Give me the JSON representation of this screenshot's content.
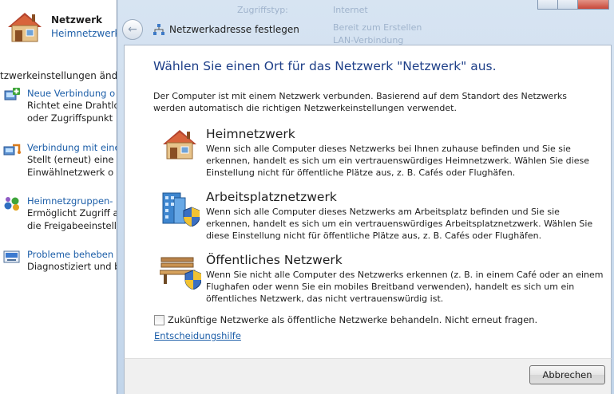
{
  "background": {
    "network": {
      "title": "Netzwerk",
      "subtitle": "Heimnetzwerk"
    },
    "settings_heading": "tzwerkeinstellungen änder",
    "tasks": [
      {
        "link": "Neue Verbindung o",
        "desc": [
          "Richtet eine Drahtlo",
          "oder Zugriffspunkt"
        ]
      },
      {
        "link": "Verbindung mit eine",
        "desc": [
          "Stellt (erneut) eine",
          "Einwählnetzwerk o"
        ]
      },
      {
        "link": "Heimnetzgruppen-",
        "desc": [
          "Ermöglicht Zugriff a",
          "die Freigabeeinstell"
        ]
      },
      {
        "link": "Probleme beheben",
        "desc": [
          "Diagnostiziert und b"
        ]
      }
    ],
    "ghost": {
      "col1": "Zugriffstyp:",
      "col2": "Internet",
      "link1": "Bereit zum Erstellen",
      "link2": "LAN-Verbindung"
    }
  },
  "dialog": {
    "nav_title": "Netzwerkadresse festlegen",
    "title": "Wählen Sie einen Ort für das Netzwerk \"Netzwerk\" aus.",
    "intro": "Der Computer ist mit einem Netzwerk verbunden. Basierend auf dem Standort des Netzwerks werden automatisch die richtigen Netzwerkeinstellungen verwendet.",
    "options": [
      {
        "title": "Heimnetzwerk",
        "icon": "house-icon",
        "desc": "Wenn sich alle Computer dieses Netzwerks bei Ihnen zuhause befinden und Sie sie erkennen, handelt es sich um ein vertrauenswürdiges Heimnetzwerk. Wählen Sie diese Einstellung nicht für öffentliche Plätze aus, z. B. Cafés oder Flughäfen."
      },
      {
        "title": "Arbeitsplatznetzwerk",
        "icon": "office-building-icon",
        "desc": "Wenn sich alle Computer dieses Netzwerks am Arbeitsplatz befinden und Sie sie erkennen, handelt es sich um ein vertrauenswürdiges Arbeitsplatznetzwerk. Wählen Sie diese Einstellung nicht für öffentliche Plätze aus, z. B. Cafés oder Flughäfen."
      },
      {
        "title": "Öffentliches Netzwerk",
        "icon": "park-bench-icon",
        "desc": "Wenn Sie nicht alle Computer des Netzwerks erkennen (z. B. in einem Café oder an einem Flughafen oder wenn Sie ein mobiles Breitband verwenden), handelt es sich um ein öffentliches Netzwerk, das nicht vertrauenswürdig ist."
      }
    ],
    "checkbox_label": "Zukünftige Netzwerke als öffentliche Netzwerke behandeln. Nicht erneut fragen.",
    "checkbox_checked": false,
    "help_link": "Entscheidungshilfe",
    "cancel_label": "Abbrechen"
  }
}
